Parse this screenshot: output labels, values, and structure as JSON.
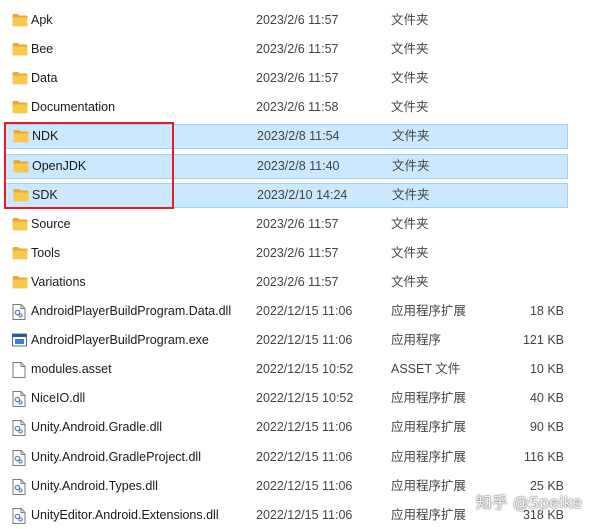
{
  "files": [
    {
      "name": "Apk",
      "date": "2023/2/6 11:57",
      "type": "文件夹",
      "size": "",
      "icon": "folder-icon",
      "selected": false
    },
    {
      "name": "Bee",
      "date": "2023/2/6 11:57",
      "type": "文件夹",
      "size": "",
      "icon": "folder-icon",
      "selected": false
    },
    {
      "name": "Data",
      "date": "2023/2/6 11:57",
      "type": "文件夹",
      "size": "",
      "icon": "folder-icon",
      "selected": false
    },
    {
      "name": "Documentation",
      "date": "2023/2/6 11:58",
      "type": "文件夹",
      "size": "",
      "icon": "folder-icon",
      "selected": false
    },
    {
      "name": "NDK",
      "date": "2023/2/8 11:54",
      "type": "文件夹",
      "size": "",
      "icon": "folder-icon",
      "selected": true
    },
    {
      "name": "OpenJDK",
      "date": "2023/2/8 11:40",
      "type": "文件夹",
      "size": "",
      "icon": "folder-icon",
      "selected": true
    },
    {
      "name": "SDK",
      "date": "2023/2/10 14:24",
      "type": "文件夹",
      "size": "",
      "icon": "folder-icon",
      "selected": true
    },
    {
      "name": "Source",
      "date": "2023/2/6 11:57",
      "type": "文件夹",
      "size": "",
      "icon": "folder-icon",
      "selected": false
    },
    {
      "name": "Tools",
      "date": "2023/2/6 11:57",
      "type": "文件夹",
      "size": "",
      "icon": "folder-icon",
      "selected": false
    },
    {
      "name": "Variations",
      "date": "2023/2/6 11:57",
      "type": "文件夹",
      "size": "",
      "icon": "folder-icon",
      "selected": false
    },
    {
      "name": "AndroidPlayerBuildProgram.Data.dll",
      "date": "2022/12/15 11:06",
      "type": "应用程序扩展",
      "size": "18 KB",
      "icon": "dll-file-icon",
      "selected": false
    },
    {
      "name": "AndroidPlayerBuildProgram.exe",
      "date": "2022/12/15 11:06",
      "type": "应用程序",
      "size": "121 KB",
      "icon": "exe-file-icon",
      "selected": false
    },
    {
      "name": "modules.asset",
      "date": "2022/12/15 10:52",
      "type": "ASSET 文件",
      "size": "10 KB",
      "icon": "blank-file-icon",
      "selected": false
    },
    {
      "name": "NiceIO.dll",
      "date": "2022/12/15 10:52",
      "type": "应用程序扩展",
      "size": "40 KB",
      "icon": "dll-file-icon",
      "selected": false
    },
    {
      "name": "Unity.Android.Gradle.dll",
      "date": "2022/12/15 11:06",
      "type": "应用程序扩展",
      "size": "90 KB",
      "icon": "dll-file-icon",
      "selected": false
    },
    {
      "name": "Unity.Android.GradleProject.dll",
      "date": "2022/12/15 11:06",
      "type": "应用程序扩展",
      "size": "116 KB",
      "icon": "dll-file-icon",
      "selected": false
    },
    {
      "name": "Unity.Android.Types.dll",
      "date": "2022/12/15 11:06",
      "type": "应用程序扩展",
      "size": "25 KB",
      "icon": "dll-file-icon",
      "selected": false
    },
    {
      "name": "UnityEditor.Android.Extensions.dll",
      "date": "2022/12/15 11:06",
      "type": "应用程序扩展",
      "size": "318 KB",
      "icon": "dll-file-icon",
      "selected": false
    }
  ],
  "watermark": "知乎 @Speike",
  "colors": {
    "selection_bg": "#cce8ff",
    "selection_border": "#99d1ff",
    "highlight_box": "#e01e2b",
    "folder": "#f8c94a"
  }
}
